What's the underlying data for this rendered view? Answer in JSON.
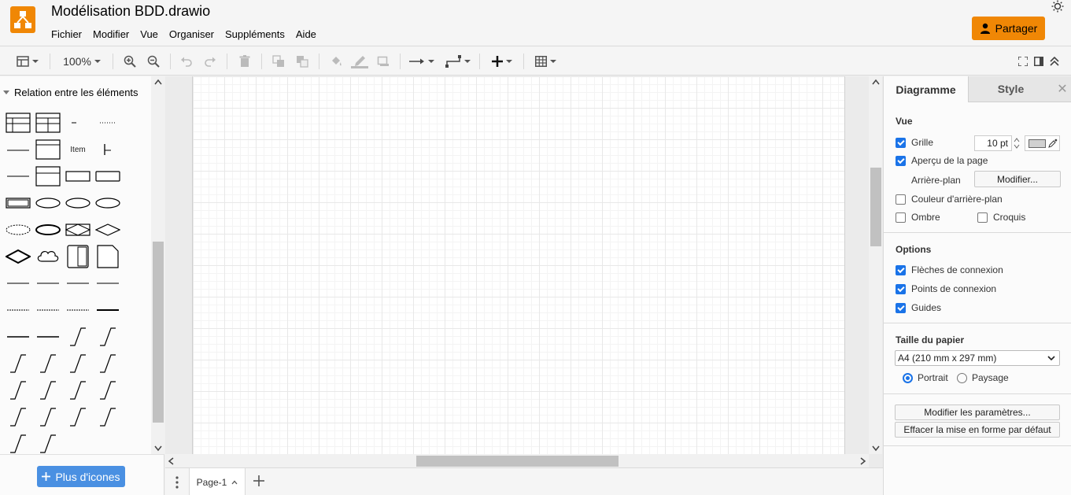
{
  "app": {
    "title": "Modélisation BDD.drawio",
    "share_label": "Partager",
    "accent": "#f08705"
  },
  "menu": [
    "Fichier",
    "Modifier",
    "Vue",
    "Organiser",
    "Suppléments",
    "Aide"
  ],
  "toolbar": {
    "zoom": "100%"
  },
  "sidebar": {
    "section_title": "Relation entre les éléments",
    "item_label": "Item",
    "more_shapes_label": "Plus d'icones"
  },
  "pages": {
    "current": "Page-1"
  },
  "format_panel": {
    "tabs": {
      "diagram": "Diagramme",
      "style": "Style"
    },
    "view": {
      "title": "Vue",
      "grid_label": "Grille",
      "grid_checked": true,
      "grid_size": "10 pt",
      "page_view_label": "Aperçu de la page",
      "page_view_checked": true,
      "background_label": "Arrière-plan",
      "background_button": "Modifier...",
      "bg_color_label": "Couleur d'arrière-plan",
      "bg_color_checked": false,
      "shadow_label": "Ombre",
      "shadow_checked": false,
      "sketch_label": "Croquis",
      "sketch_checked": false
    },
    "options": {
      "title": "Options",
      "connection_arrows": "Flèches de connexion",
      "connection_points": "Points de connexion",
      "guides": "Guides"
    },
    "paper": {
      "title": "Taille du papier",
      "size": "A4 (210 mm x 297 mm)",
      "portrait": "Portrait",
      "landscape": "Paysage",
      "orientation": "portrait"
    },
    "buttons": {
      "edit_data": "Modifier les paramètres...",
      "clear_default_style": "Effacer la mise en forme par défaut"
    }
  }
}
